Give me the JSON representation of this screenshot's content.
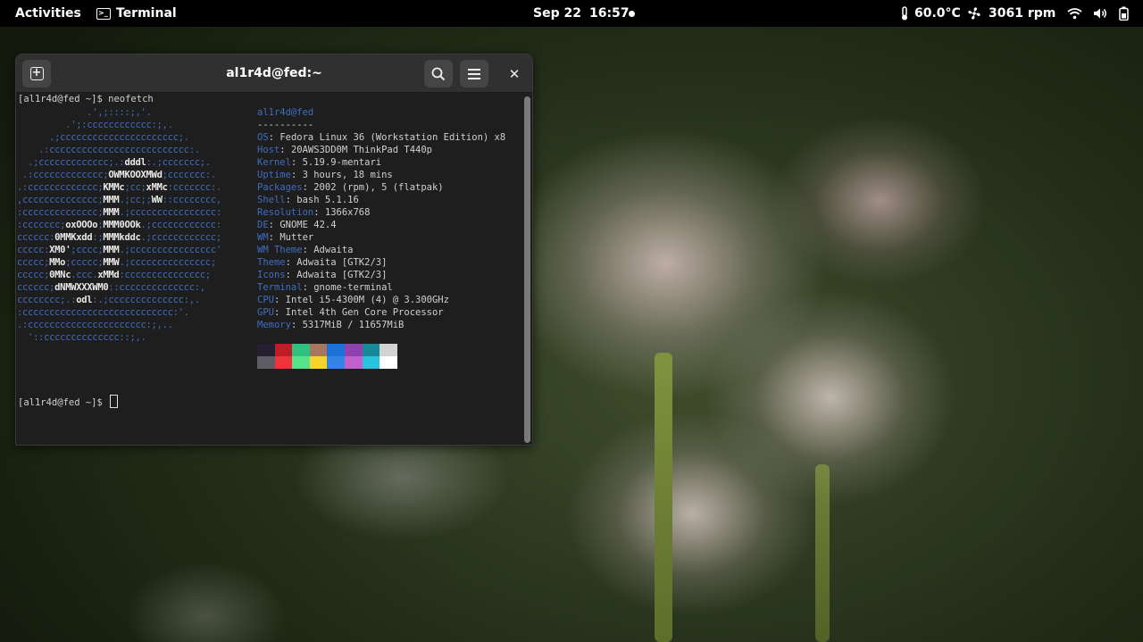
{
  "topbar": {
    "activities": "Activities",
    "app_name": "Terminal",
    "date": "Sep 22",
    "time": "16:57",
    "temperature": "60.0°C",
    "fan_speed": "3061 rpm"
  },
  "window": {
    "title": "al1r4d@fed:~"
  },
  "terminal": {
    "prompt1": "[al1r4d@fed ~]$ neofetch",
    "prompt2": "[al1r4d@fed ~]$ ",
    "logo": [
      "             .',;::::;,'.",
      "         .';:cccccccccccc:;,.",
      "      .;cccccccccccccccccccccc;.",
      "    .:cccccccccccccccccccccccccc:.",
      "  .;ccccccccccccc;.:dddl:.;ccccccc;.",
      " .:ccccccccccccc;OWMKOOXMWd;ccccccc:.",
      ".:ccccccccccccc;KMMc;cc;xMMc:ccccccc:.",
      ",cccccccccccccc;MMM.;cc;;WW::cccccccc,",
      ":cccccccccccccc;MMM.;cccccccccccccccc:",
      ":ccccccc;oxOOOo;MMM0OOk.;cccccccccccc:",
      "cccccc:0MMKxdd:;MMMkddc.;cccccccccccc;",
      "ccccc:XM0';cccc;MMM.;cccccccccccccccc'",
      "ccccc;MMo;ccccc;MMW.;ccccccccccccccc;",
      "ccccc;0MNc.ccc.xMMd:ccccccccccccccc;",
      "cccccc;dNMWXXXWM0::cccccccccccccc:,",
      "cccccccc;.:odl:.;cccccccccccccc:,.",
      ":cccccccccccccccccccccccccccc:'.",
      ".:cccccccccccccccccccccc:;,..",
      "  '::cccccccccccccc::;,."
    ],
    "info_header": "al1r4d@fed",
    "info_separator": "----------",
    "info": [
      {
        "label": "OS",
        "value": "Fedora Linux 36 (Workstation Edition) x8"
      },
      {
        "label": "Host",
        "value": "20AWS3DD0M ThinkPad T440p"
      },
      {
        "label": "Kernel",
        "value": "5.19.9-mentari"
      },
      {
        "label": "Uptime",
        "value": "3 hours, 18 mins"
      },
      {
        "label": "Packages",
        "value": "2002 (rpm), 5 (flatpak)"
      },
      {
        "label": "Shell",
        "value": "bash 5.1.16"
      },
      {
        "label": "Resolution",
        "value": "1366x768"
      },
      {
        "label": "DE",
        "value": "GNOME 42.4"
      },
      {
        "label": "WM",
        "value": "Mutter"
      },
      {
        "label": "WM Theme",
        "value": "Adwaita"
      },
      {
        "label": "Theme",
        "value": "Adwaita [GTK2/3]"
      },
      {
        "label": "Icons",
        "value": "Adwaita [GTK2/3]"
      },
      {
        "label": "Terminal",
        "value": "gnome-terminal"
      },
      {
        "label": "CPU",
        "value": "Intel i5-4300M (4) @ 3.300GHz"
      },
      {
        "label": "GPU",
        "value": "Intel 4th Gen Core Processor"
      },
      {
        "label": "Memory",
        "value": "5317MiB / 11657MiB"
      }
    ],
    "palette_dark": [
      "#241f31",
      "#c01c28",
      "#2ec27e",
      "#a7765d",
      "#1c71d8",
      "#9141ac",
      "#178a9a",
      "#d3d3d3"
    ],
    "palette_bright": [
      "#5e5c64",
      "#ed333b",
      "#57e389",
      "#f6d32d",
      "#3584e4",
      "#c061cb",
      "#2ac3de",
      "#ffffff"
    ]
  }
}
